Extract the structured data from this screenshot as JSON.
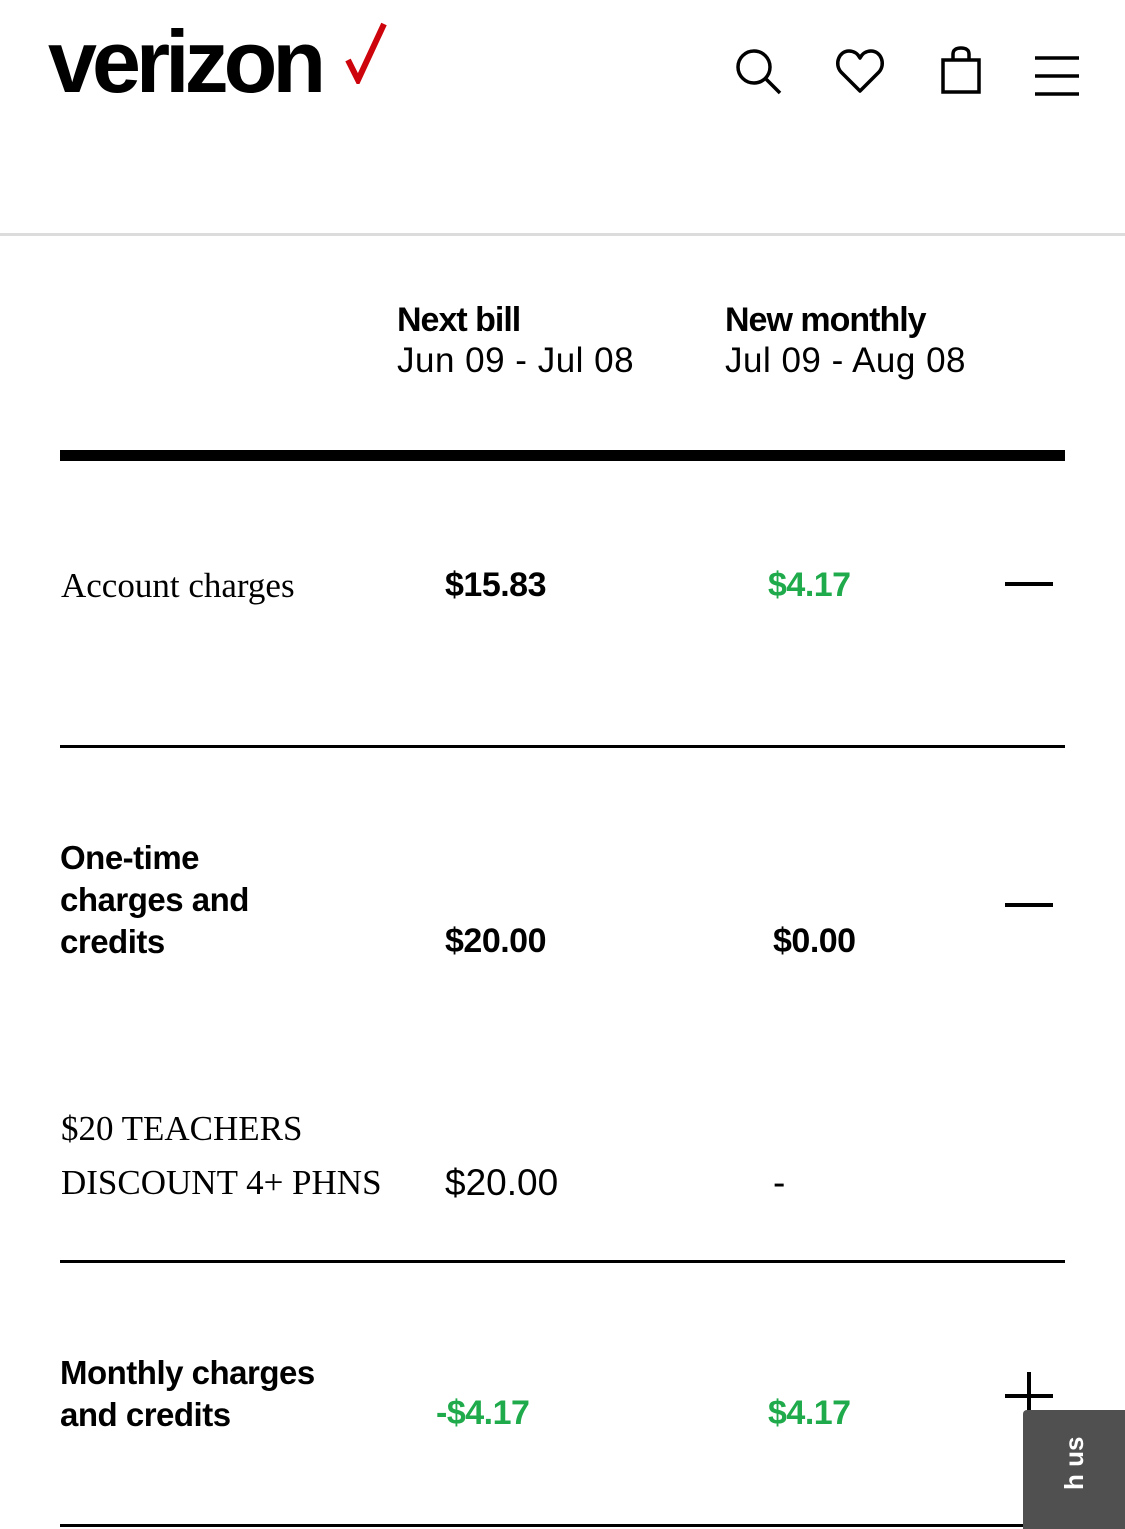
{
  "header": {
    "logo_text": "verizon",
    "logo_check_color": "#cd040b",
    "icons": [
      "search-icon",
      "heart-icon",
      "shopping-bag-icon",
      "menu-icon"
    ]
  },
  "columns": {
    "next_bill": {
      "title": "Next bill",
      "dates": "Jun 09 - Jul 08"
    },
    "new_monthly": {
      "title": "New monthly",
      "dates": "Jul 09 - Aug 08"
    }
  },
  "rows": {
    "account_charges": {
      "label": "Account charges",
      "next_bill": "$15.83",
      "new_monthly": "$4.17",
      "toggle": "collapse"
    },
    "one_time": {
      "label_lines": [
        "One-time",
        "charges and",
        "credits"
      ],
      "next_bill": "$20.00",
      "new_monthly": "$0.00",
      "toggle": "collapse"
    },
    "teachers_discount": {
      "label_lines": [
        "$20 TEACHERS",
        "DISCOUNT 4+ PHNS"
      ],
      "next_bill": "$20.00",
      "new_monthly": "-"
    },
    "monthly": {
      "label_lines": [
        "Monthly charges",
        "and credits"
      ],
      "next_bill": "-$4.17",
      "new_monthly": "$4.17",
      "toggle": "expand"
    }
  },
  "chat_tab": {
    "label": "h us"
  },
  "colors": {
    "credit_green": "#1faa4b",
    "text": "#000000"
  }
}
